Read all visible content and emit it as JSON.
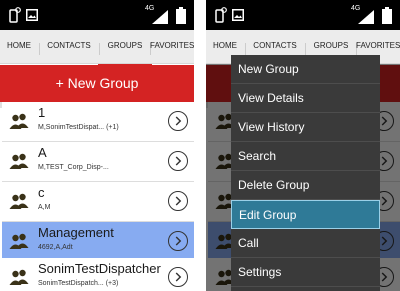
{
  "status_bar": {
    "network": "4G"
  },
  "tabs": [
    {
      "label": "HOME"
    },
    {
      "label": "CONTACTS"
    },
    {
      "label": "GROUPS"
    },
    {
      "label": "FAVORITES"
    }
  ],
  "new_group_label": "+ New Group",
  "groups": [
    {
      "name": "1",
      "members": "M,SonimTestDispat... (+1)"
    },
    {
      "name": "A",
      "members": "M,TEST_Corp_Disp-..."
    },
    {
      "name": "c",
      "members": "A,M"
    },
    {
      "name": "Management",
      "members": "4692,A,Adt",
      "selected": true
    },
    {
      "name": "SonimTestDispatcher",
      "members": "SonimTestDispatch... (+3)"
    }
  ],
  "context_menu": [
    {
      "label": "New Group"
    },
    {
      "label": "View Details"
    },
    {
      "label": "View History"
    },
    {
      "label": "Search"
    },
    {
      "label": "Delete Group"
    },
    {
      "label": "Edit Group",
      "selected": true
    },
    {
      "label": "Call"
    },
    {
      "label": "Settings"
    }
  ],
  "colors": {
    "accent": "#d42323",
    "selected_row": "#87abf1",
    "menu_bg": "#3a3a3a",
    "menu_selected": "#2f7a97"
  },
  "icons": {
    "status_left": [
      "phone-settings-icon",
      "image-icon"
    ],
    "status_right": [
      "signal-icon",
      "battery-icon"
    ],
    "group_avatar": "group-people-icon",
    "row_action": "chevron-right-circle-icon"
  }
}
